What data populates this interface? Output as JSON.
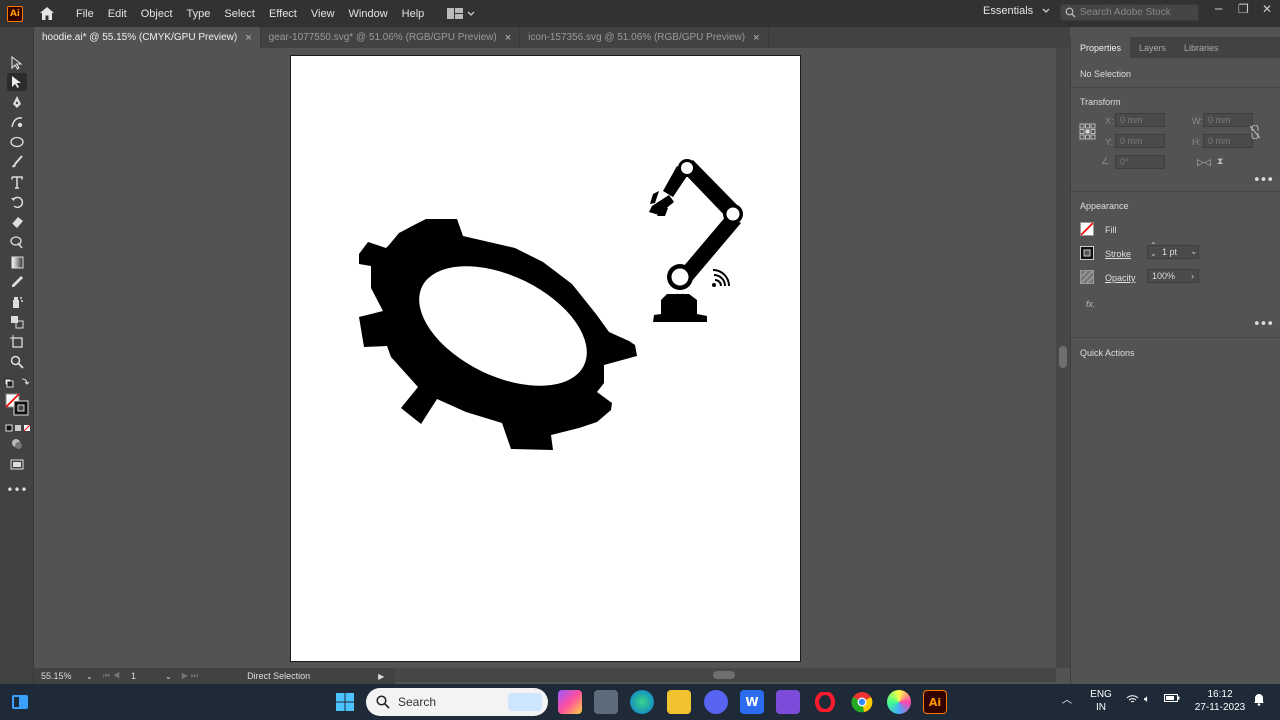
{
  "app": {
    "logo_text": "Ai",
    "workspace": "Essentials",
    "search_placeholder": "Search Adobe Stock"
  },
  "menu": [
    "File",
    "Edit",
    "Object",
    "Type",
    "Select",
    "Effect",
    "View",
    "Window",
    "Help"
  ],
  "tabs": [
    {
      "label": "hoodie.ai* @ 55.15% (CMYK/GPU Preview)",
      "close": "×"
    },
    {
      "label": "gear-1077550.svg* @ 51.06% (RGB/GPU Preview)",
      "close": "×"
    },
    {
      "label": "icon-157356.svg @ 51.06% (RGB/GPU Preview)",
      "close": "×"
    }
  ],
  "status": {
    "zoom": "55.15%",
    "artboard": "1",
    "tool": "Direct Selection"
  },
  "panel": {
    "tabs": [
      "Properties",
      "Layers",
      "Libraries"
    ],
    "selection": "No Selection",
    "transform": {
      "title": "Transform",
      "x_label": "X:",
      "x_value": "0 mm",
      "y_label": "Y:",
      "y_value": "0 mm",
      "w_label": "W:",
      "w_value": "0 mm",
      "h_label": "H:",
      "h_value": "0 mm",
      "angle_value": "0°"
    },
    "appearance": {
      "title": "Appearance",
      "fill_label": "Fill",
      "stroke_label": "Stroke",
      "stroke_value": "1 pt",
      "opacity_label": "Opacity",
      "opacity_value": "100%",
      "fx_label": "fx."
    },
    "quick_actions": "Quick Actions"
  },
  "taskbar": {
    "search": "Search",
    "lang_line1": "ENG",
    "lang_line2": "IN",
    "time": "16:12",
    "date": "27-11-2023"
  }
}
